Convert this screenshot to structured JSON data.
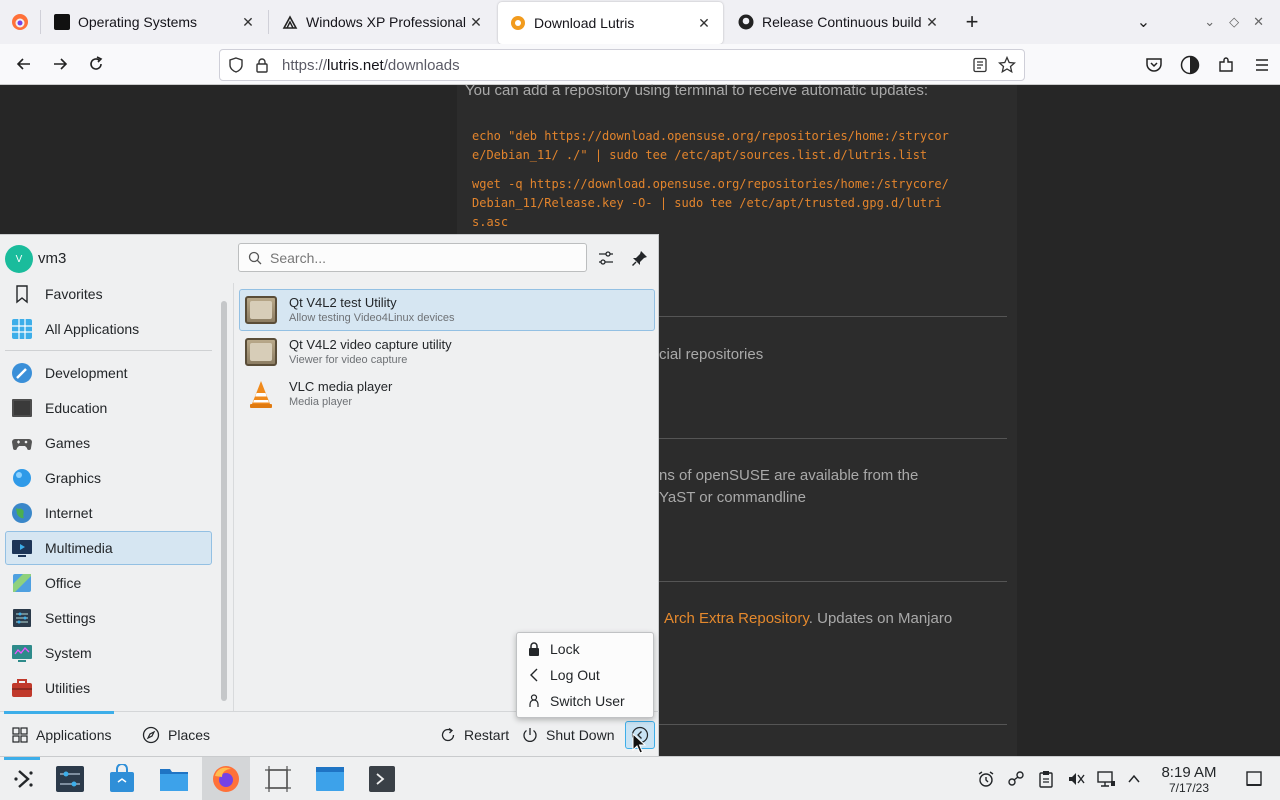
{
  "browser": {
    "tabs": [
      {
        "title": "Operating Systems",
        "icon": "terminal-favicon",
        "active": false
      },
      {
        "title": "Windows XP Professional S",
        "icon": "archive-favicon",
        "active": false
      },
      {
        "title": "Download Lutris",
        "icon": "lutris-favicon",
        "active": true
      },
      {
        "title": "Release Continuous build",
        "icon": "github-favicon",
        "active": false
      }
    ],
    "url_prefix": "https://",
    "url_domain": "lutris.net",
    "url_path": "/downloads"
  },
  "page": {
    "repo_intro": "You can add a repository using terminal to receive automatic updates:",
    "code1_line1": "echo \"deb https://download.opensuse.org/repositories/home:/strycor",
    "code1_line2": "e/Debian_11/ ./\" | sudo tee /etc/apt/sources.list.d/lutris.list",
    "code2_line1": "wget -q https://download.opensuse.org/repositories/home:/strycore/",
    "code2_line2": "Debian_11/Release.key -O- | sudo tee /etc/apt/trusted.gpg.d/lutri",
    "code2_line3": "s.asc",
    "frag_official": "cial repositories",
    "frag_opensuse1": "ns of openSUSE are available from the",
    "frag_opensuse2": "YaST or commandline",
    "frag_arch_link": "Arch Extra Repository",
    "frag_manjaro": ". Updates on Manjaro"
  },
  "launcher": {
    "user": {
      "initial": "V",
      "name": "vm3"
    },
    "search_placeholder": "Search...",
    "categories": [
      {
        "label": "Favorites",
        "icon": "bookmark-icon",
        "color": ""
      },
      {
        "label": "All Applications",
        "icon": "grid-icon",
        "color": "#3daee9"
      },
      {
        "label": "Development",
        "icon": "development-icon",
        "color": "#3a8fd8"
      },
      {
        "label": "Education",
        "icon": "education-icon",
        "color": "#4d4d4d"
      },
      {
        "label": "Games",
        "icon": "gamepad-icon",
        "color": "#555"
      },
      {
        "label": "Graphics",
        "icon": "graphics-icon",
        "color": "#2f9ae8"
      },
      {
        "label": "Internet",
        "icon": "globe-icon",
        "color": "#3b9c5a"
      },
      {
        "label": "Multimedia",
        "icon": "multimedia-icon",
        "color": "#1d3557"
      },
      {
        "label": "Office",
        "icon": "office-icon",
        "color": "#4fa0e0"
      },
      {
        "label": "Settings",
        "icon": "settings-icon",
        "color": "#2b3a4a"
      },
      {
        "label": "System",
        "icon": "system-icon",
        "color": "#2e8b8b"
      },
      {
        "label": "Utilities",
        "icon": "utilities-icon",
        "color": "#c0392b"
      }
    ],
    "apps": [
      {
        "title": "Qt V4L2 test Utility",
        "subtitle": "Allow testing Video4Linux devices"
      },
      {
        "title": "Qt V4L2 video capture utility",
        "subtitle": "Viewer for video capture"
      },
      {
        "title": "VLC media player",
        "subtitle": "Media player"
      }
    ],
    "footer": {
      "applications": "Applications",
      "places": "Places",
      "restart": "Restart",
      "shutdown": "Shut Down"
    },
    "power_menu": [
      "Lock",
      "Log Out",
      "Switch User"
    ]
  },
  "taskbar": {
    "time": "8:19 AM",
    "date": "7/17/23"
  }
}
